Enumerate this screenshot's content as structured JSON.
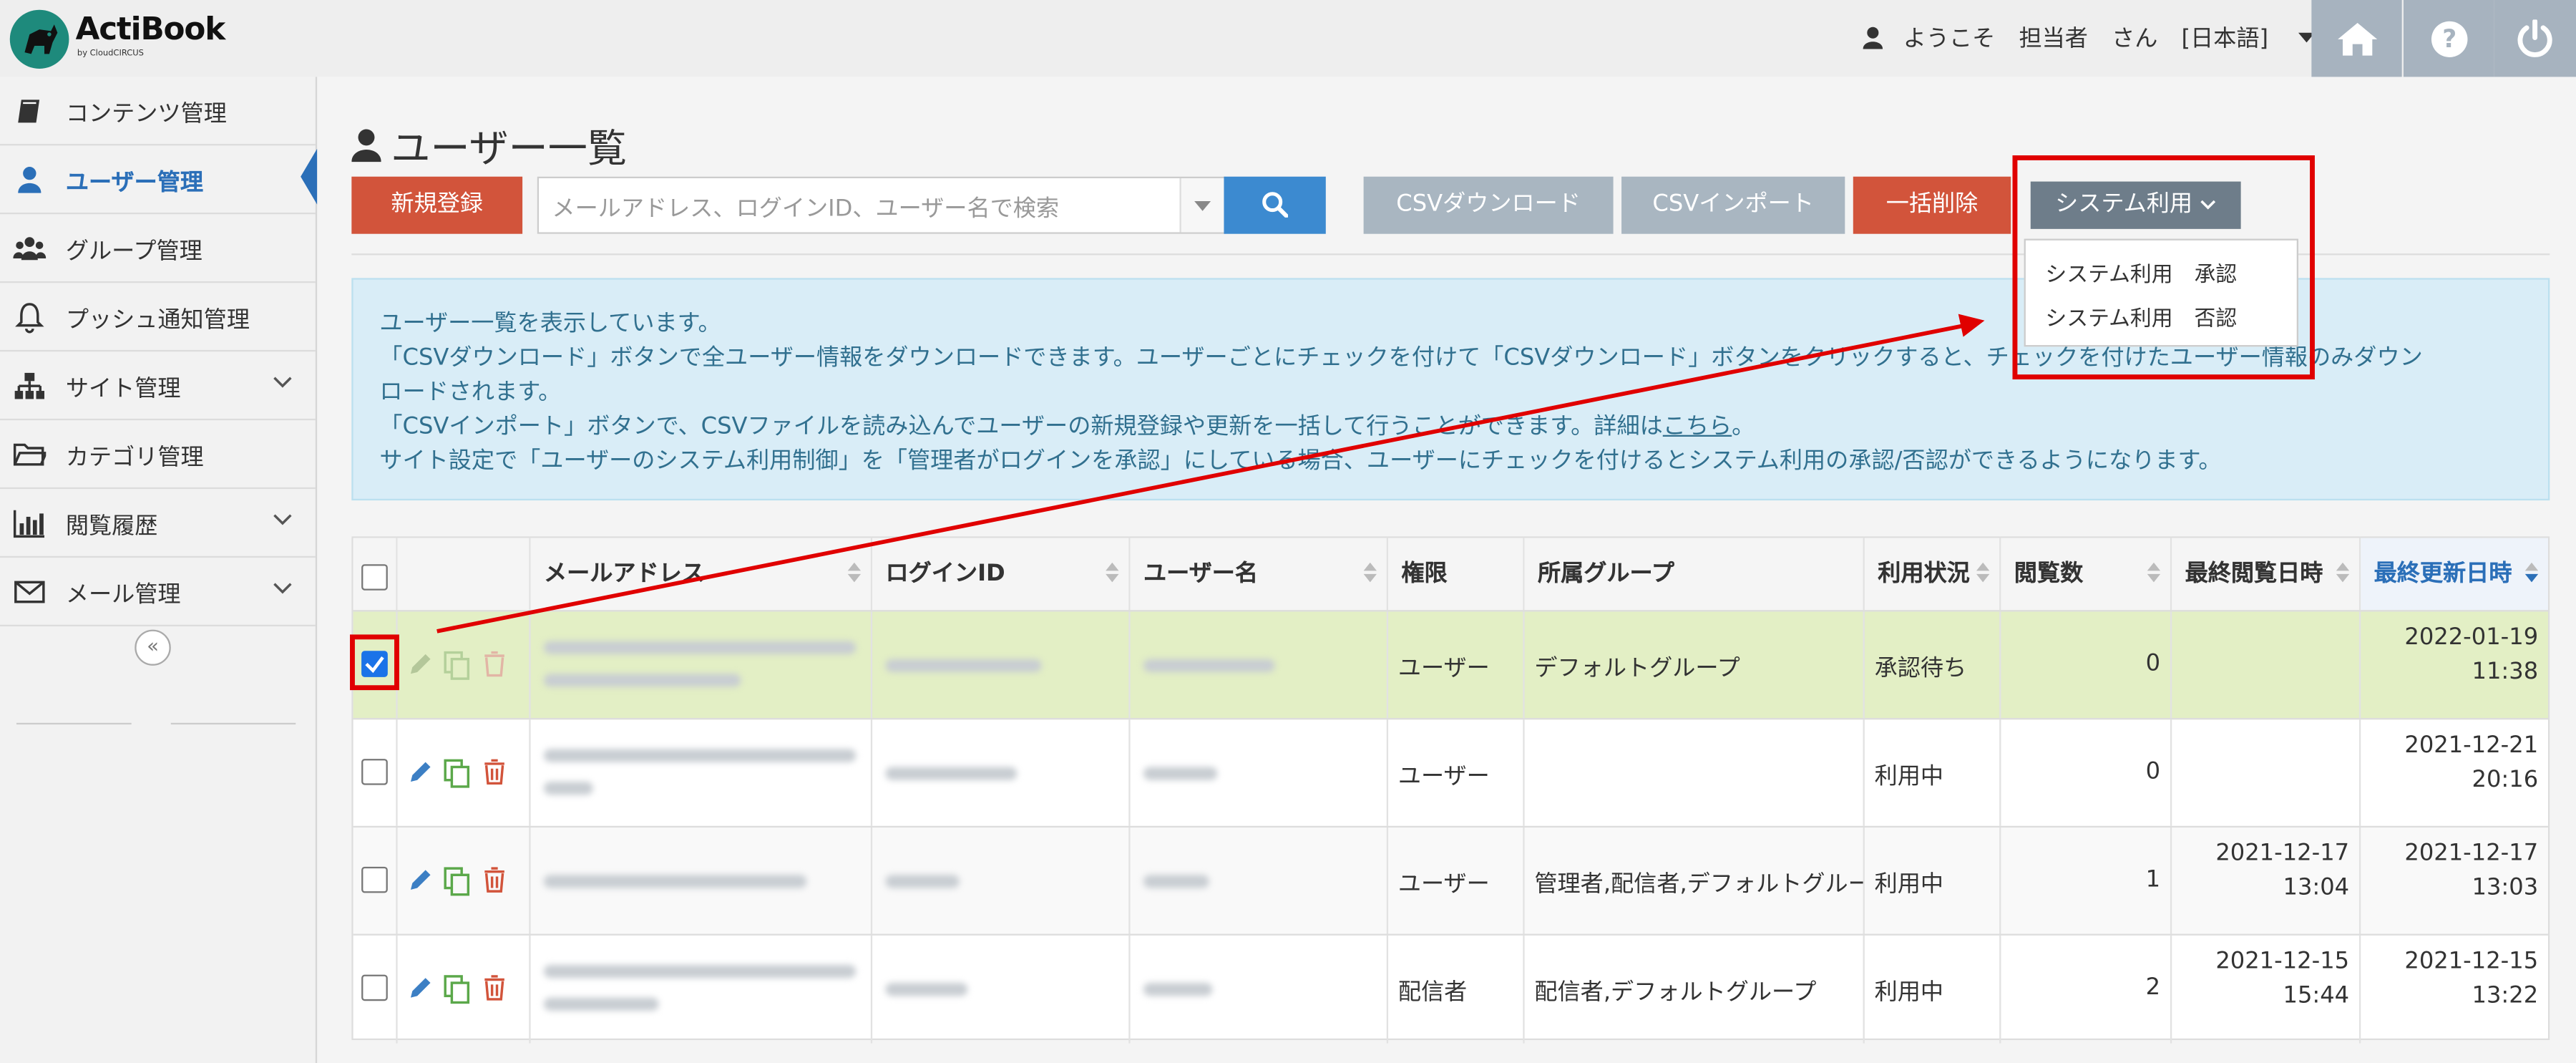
{
  "header": {
    "logo_text": "ActiBook",
    "logo_sub": "by CloudCIRCUS",
    "welcome": "ようこそ",
    "user": "担当者",
    "san": "さん",
    "language": "[日本語]",
    "icons": [
      "home-icon",
      "help-icon",
      "power-icon"
    ]
  },
  "sidebar": {
    "items": [
      {
        "label": "コンテンツ管理",
        "icon": "book-icon"
      },
      {
        "label": "ユーザー管理",
        "icon": "user-icon"
      },
      {
        "label": "グループ管理",
        "icon": "users-icon"
      },
      {
        "label": "プッシュ通知管理",
        "icon": "bell-icon"
      },
      {
        "label": "サイト管理",
        "icon": "sitemap-icon"
      },
      {
        "label": "カテゴリ管理",
        "icon": "folder-icon"
      },
      {
        "label": "閲覧履歴",
        "icon": "bar-chart-icon"
      },
      {
        "label": "メール管理",
        "icon": "mail-icon"
      }
    ],
    "collapse": "«"
  },
  "main": {
    "title": "ユーザー一覧",
    "new_button": "新規登録",
    "search_placeholder": "メールアドレス、ログインID、ユーザー名で検索",
    "csv_download": "CSVダウンロード",
    "csv_import": "CSVインポート",
    "bulk_delete": "一括削除",
    "system_use": "システム利用",
    "dropdown": [
      "システム利用　承認",
      "システム利用　否認"
    ]
  },
  "info": {
    "line1": "ユーザー一覧を表示しています。",
    "line2": "「CSVダウンロード」ボタンで全ユーザー情報をダウンロードできます。ユーザーごとにチェックを付けて「CSVダウンロード」ボタンをクリックすると、チェックを付けたユーザー情報のみダウン",
    "line3": "ロードされます。",
    "line4": "「CSVインポート」ボタンで、CSVファイルを読み込んでユーザーの新規登録や更新を一括して行うことができます。詳細は",
    "link": "こちら",
    "line4_end": "。",
    "line5": "サイト設定で「ユーザーのシステム利用制御」を「管理者がログインを承認」にしている場合、ユーザーにチェックを付けるとシステム利用の承認/否認ができるようになります。"
  },
  "table": {
    "headers": [
      "メールアドレス",
      "ログインID",
      "ユーザー名",
      "権限",
      "所属グループ",
      "利用状況",
      "閲覧数",
      "最終閲覧日時",
      "最終更新日時"
    ],
    "rows": [
      {
        "role": "ユーザー",
        "group": "デフォルトグループ",
        "status": "承認待ち",
        "views": "0",
        "last_view_date": "",
        "last_view_time": "",
        "updated_date": "2022-01-19",
        "updated_time": "11:38",
        "checked": true
      },
      {
        "role": "ユーザー",
        "group": "",
        "status": "利用中",
        "views": "0",
        "last_view_date": "",
        "last_view_time": "",
        "updated_date": "2021-12-21",
        "updated_time": "20:16",
        "checked": false
      },
      {
        "role": "ユーザー",
        "group": "管理者,配信者,デフォルトグループ",
        "status": "利用中",
        "views": "1",
        "last_view_date": "2021-12-17",
        "last_view_time": "13:04",
        "updated_date": "2021-12-17",
        "updated_time": "13:03",
        "checked": false
      },
      {
        "role": "配信者",
        "group": "配信者,デフォルトグループ",
        "status": "利用中",
        "views": "2",
        "last_view_date": "2021-12-15",
        "last_view_time": "15:44",
        "updated_date": "2021-12-15",
        "updated_time": "13:22",
        "checked": false
      }
    ]
  },
  "colors": {
    "accent_blue": "#2b6fb8",
    "danger_red": "#d2543b",
    "annotation_red": "#e00000",
    "highlight_row": "#e3efc5"
  }
}
